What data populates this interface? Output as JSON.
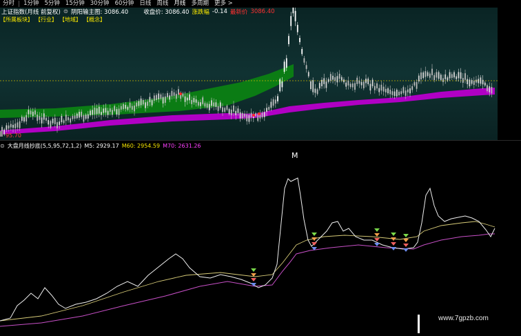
{
  "toolbar": {
    "periods": [
      "分时",
      "1分钟",
      "5分钟",
      "15分钟",
      "30分钟",
      "60分钟",
      "日线",
      "周线",
      "月线",
      "多周期",
      "更多 >"
    ],
    "active_period": "月线"
  },
  "info": {
    "title": "上证指数(月线 前复权)",
    "ind_toggle": "阴阳输主图: 3086.40",
    "close_label": "收盘价: 3086.40",
    "change_label": "涨跌幅",
    "change_value": "-0.14",
    "last_label": "最新价",
    "last_value": "3086.40"
  },
  "tags": [
    "【所属板块】",
    "【行业】",
    "【地域】",
    "【概念】"
  ],
  "main_chart": {
    "min_label": "95.70",
    "dashed_level_label": "",
    "colors": {
      "up": "#ff3232",
      "down": "#54ffff",
      "band_green": "#0a7d12",
      "band_purple": "#b400c8",
      "bg": "#0e2b2b"
    }
  },
  "indicator": {
    "name": "大盘月线抄底(5,5,95,72,1,2)",
    "ma5_label": "M5: 2929.17",
    "ma60_label": "M60: 2954.59",
    "ma70_label": "M70: 2631.26",
    "peak_label": "M",
    "colors": {
      "main": "#ffffff",
      "ma60": "#d8cc78",
      "ma70": "#c850c8"
    }
  },
  "watermark": "www.7gpzb.com"
}
